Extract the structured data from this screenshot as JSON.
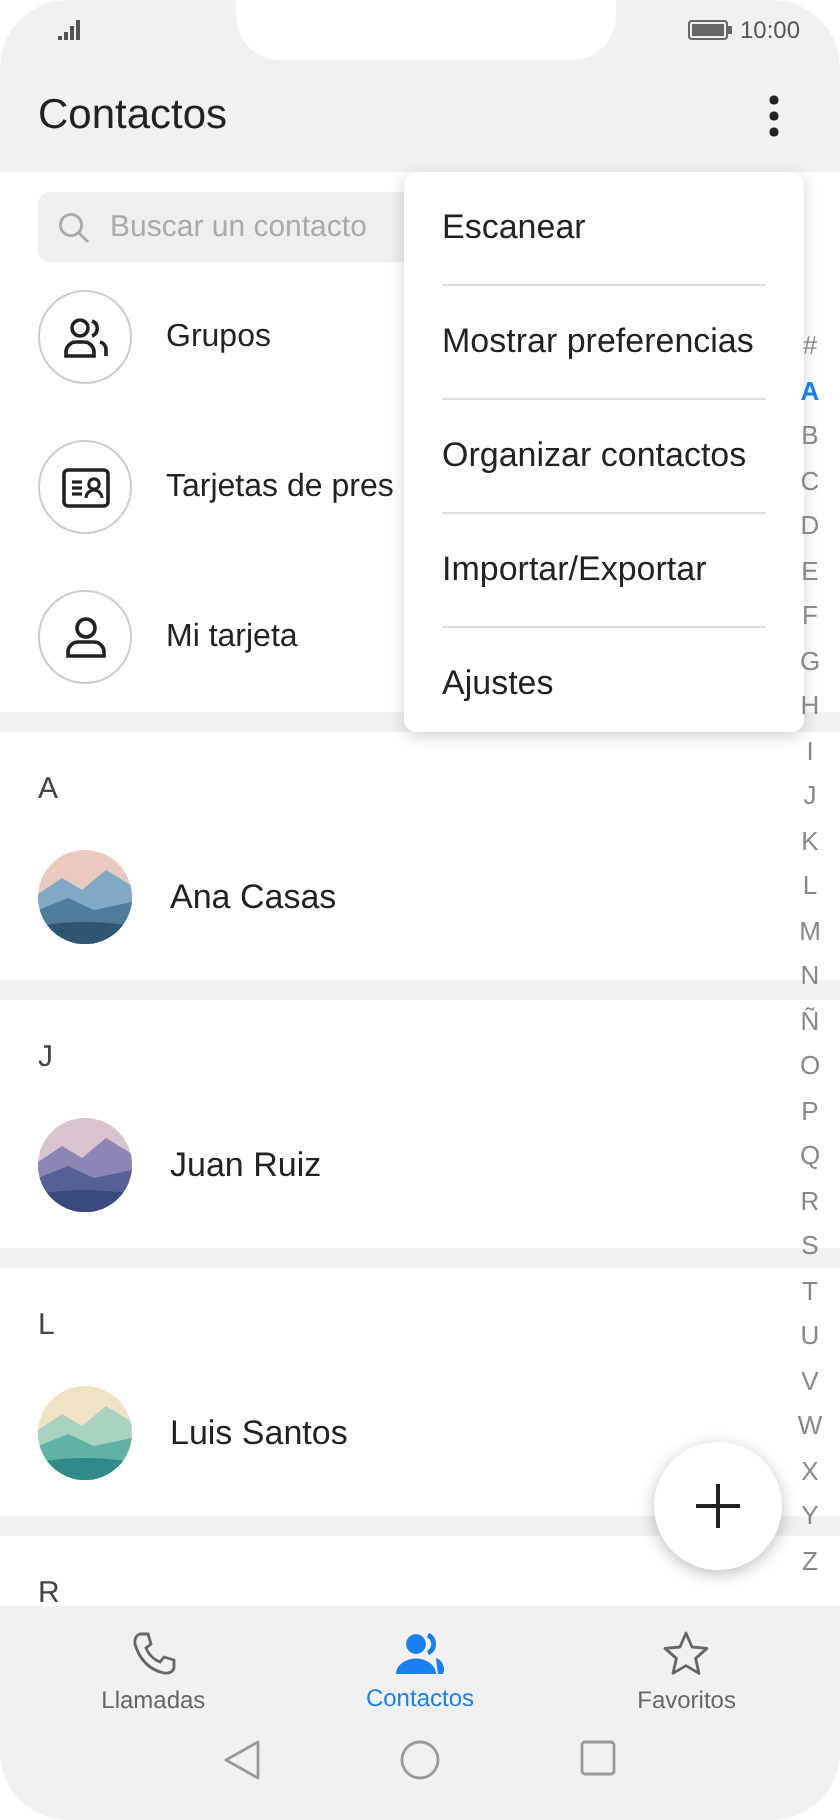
{
  "status_bar": {
    "time": "10:00"
  },
  "header": {
    "title": "Contactos"
  },
  "search": {
    "placeholder": "Buscar un contacto"
  },
  "shortcuts": [
    {
      "label": "Grupos",
      "kind": "groups"
    },
    {
      "label": "Tarjetas de pres",
      "kind": "card"
    },
    {
      "label": "Mi tarjeta",
      "kind": "person"
    }
  ],
  "sections": [
    {
      "letter": "A",
      "contacts": [
        {
          "name": "Ana Casas"
        }
      ]
    },
    {
      "letter": "J",
      "contacts": [
        {
          "name": "Juan Ruiz"
        }
      ]
    },
    {
      "letter": "L",
      "contacts": [
        {
          "name": "Luis Santos"
        }
      ]
    },
    {
      "letter": "R"
    }
  ],
  "menu": {
    "items": [
      "Escanear",
      "Mostrar preferencias",
      "Organizar contactos",
      "Importar/Exportar",
      "Ajustes"
    ]
  },
  "index": [
    {
      "label": "#",
      "selected": false
    },
    {
      "label": "A",
      "selected": true
    },
    {
      "label": "B",
      "selected": false
    },
    {
      "label": "C",
      "selected": false
    },
    {
      "label": "D",
      "selected": false
    },
    {
      "label": "E",
      "selected": false
    },
    {
      "label": "F",
      "selected": false
    },
    {
      "label": "G",
      "selected": false
    },
    {
      "label": "H",
      "selected": false
    },
    {
      "label": "I",
      "selected": false
    },
    {
      "label": "J",
      "selected": false
    },
    {
      "label": "K",
      "selected": false
    },
    {
      "label": "L",
      "selected": false
    },
    {
      "label": "M",
      "selected": false
    },
    {
      "label": "N",
      "selected": false
    },
    {
      "label": "Ñ",
      "selected": false
    },
    {
      "label": "O",
      "selected": false
    },
    {
      "label": "P",
      "selected": false
    },
    {
      "label": "Q",
      "selected": false
    },
    {
      "label": "R",
      "selected": false
    },
    {
      "label": "S",
      "selected": false
    },
    {
      "label": "T",
      "selected": false
    },
    {
      "label": "U",
      "selected": false
    },
    {
      "label": "V",
      "selected": false
    },
    {
      "label": "W",
      "selected": false
    },
    {
      "label": "X",
      "selected": false
    },
    {
      "label": "Y",
      "selected": false
    },
    {
      "label": "Z",
      "selected": false
    }
  ],
  "tabs": [
    {
      "label": "Llamadas",
      "kind": "phone",
      "selected": false
    },
    {
      "label": "Contactos",
      "kind": "people",
      "selected": true
    },
    {
      "label": "Favoritos",
      "kind": "star",
      "selected": false
    }
  ]
}
